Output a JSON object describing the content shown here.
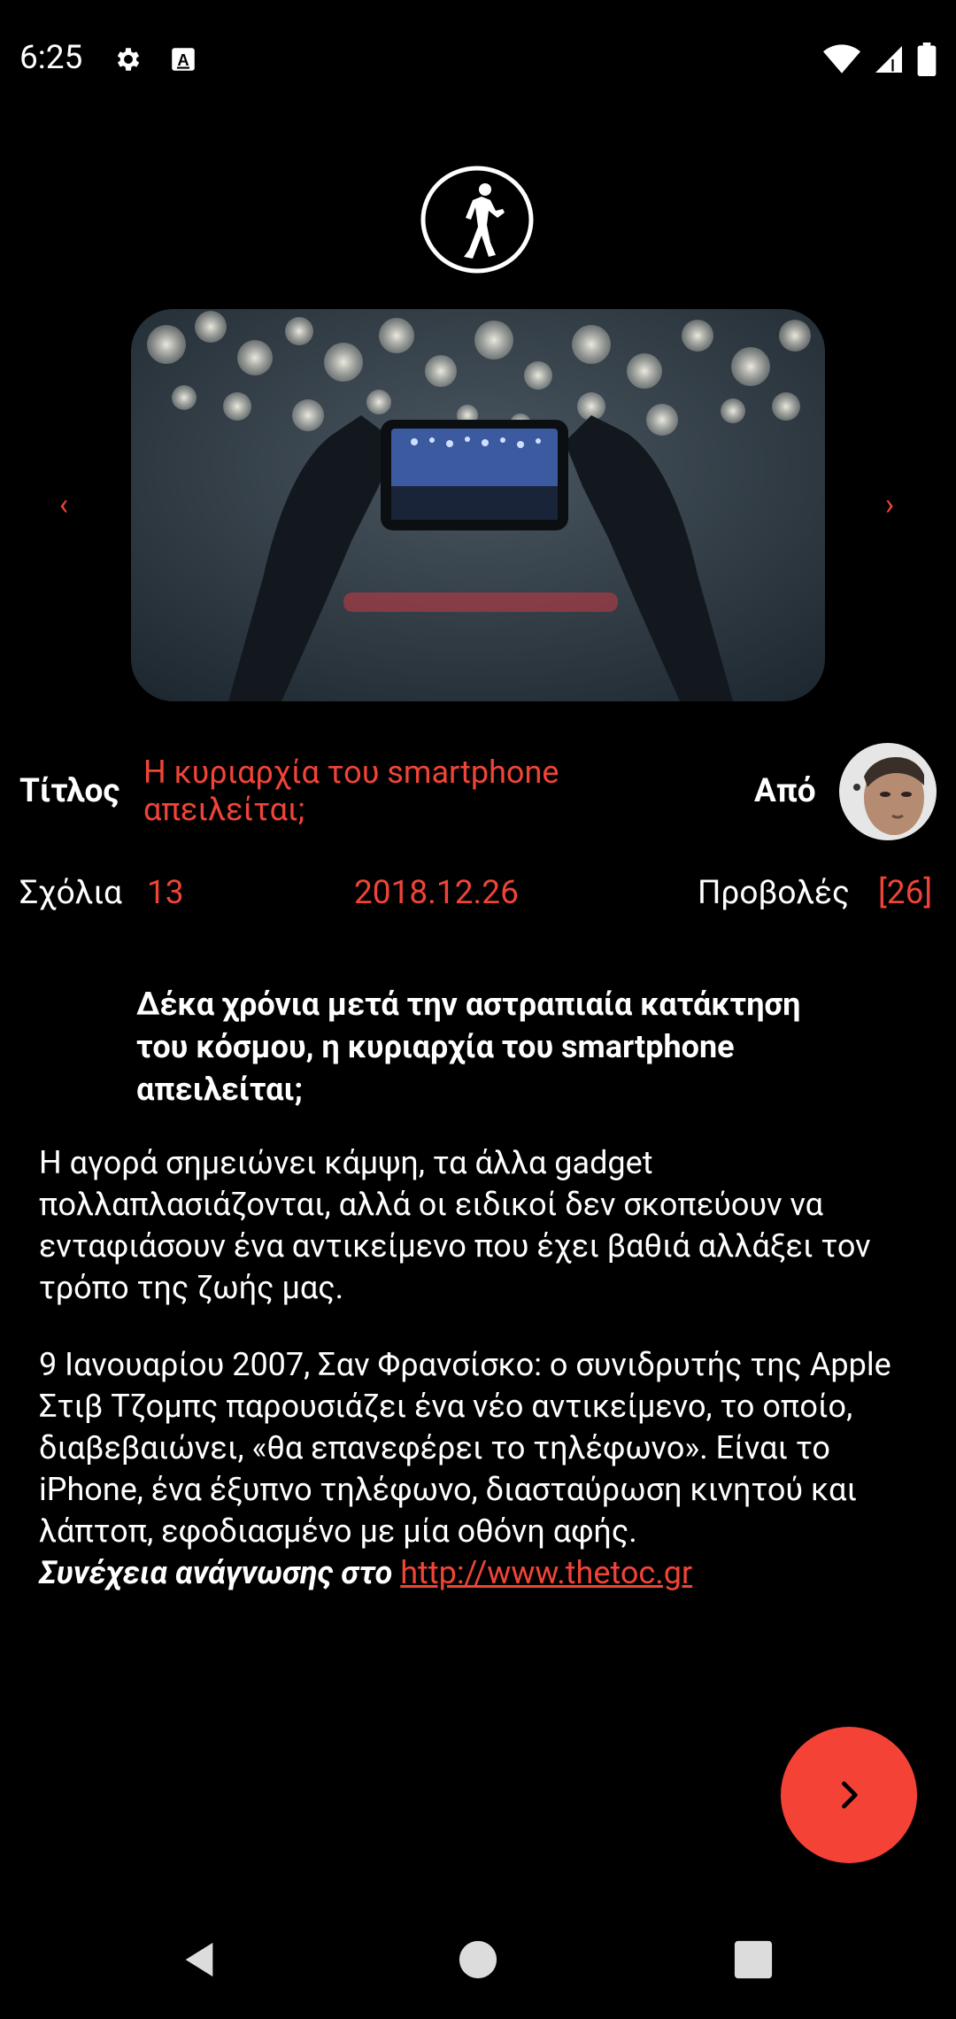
{
  "status_bar": {
    "time": "6:25",
    "icons_left": [
      "settings-icon",
      "keyboard-a-icon"
    ],
    "icons_right": [
      "wifi-icon",
      "cell-signal-icon",
      "battery-icon"
    ]
  },
  "logo": {
    "icon": "walking-man-logo-icon"
  },
  "carousel": {
    "prev_label": "‹",
    "next_label": "›",
    "image": "person-photographing-bokeh-lights-with-smartphone"
  },
  "article": {
    "title_label": "Τίτλος",
    "title_value": "Η κυριαρχία του smartphone απειλείται;",
    "author_label": "Από",
    "comments_label": "Σχόλια",
    "comments_count": "13",
    "date": "2018.12.26",
    "views_label": "Προβολές",
    "views_count": "[26]",
    "subtitle": "Δέκα χρόνια μετά την αστραπιαία κατάκτηση του κόσμου, η κυριαρχία του smartphone απειλείται;",
    "paragraph1": "Η αγορά σημειώνει κάμψη, τα άλλα gadget πολλαπλασιάζονται, αλλά οι ειδικοί δεν σκοπεύουν να ενταφιάσουν ένα αντικείμενο που έχει βαθιά αλλάξει τον τρόπο της ζωής μας.",
    "paragraph2": "9 Ιανουαρίου 2007, Σαν Φρανσίσκο: ο συνιδρυτής της Apple Στιβ Τζομπς παρουσιάζει ένα νέο αντικείμενο, το οποίο, διαβεβαιώνει, «θα επανεφέρει το τηλέφωνο». Είναι το iPhone, ένα έξυπνο τηλέφωνο, διασταύρωση κινητού και λάπτοπ, εφοδιασμένο με μία οθόνη αφής.",
    "read_more_label": "Συνέχεια ανάγνωσης στο",
    "read_more_link": "http://www.thetoc.gr"
  },
  "fab": {
    "icon": "chevron-right-icon"
  },
  "colors": {
    "accent": "#f04438",
    "fab": "#f44336",
    "background": "#000000"
  }
}
